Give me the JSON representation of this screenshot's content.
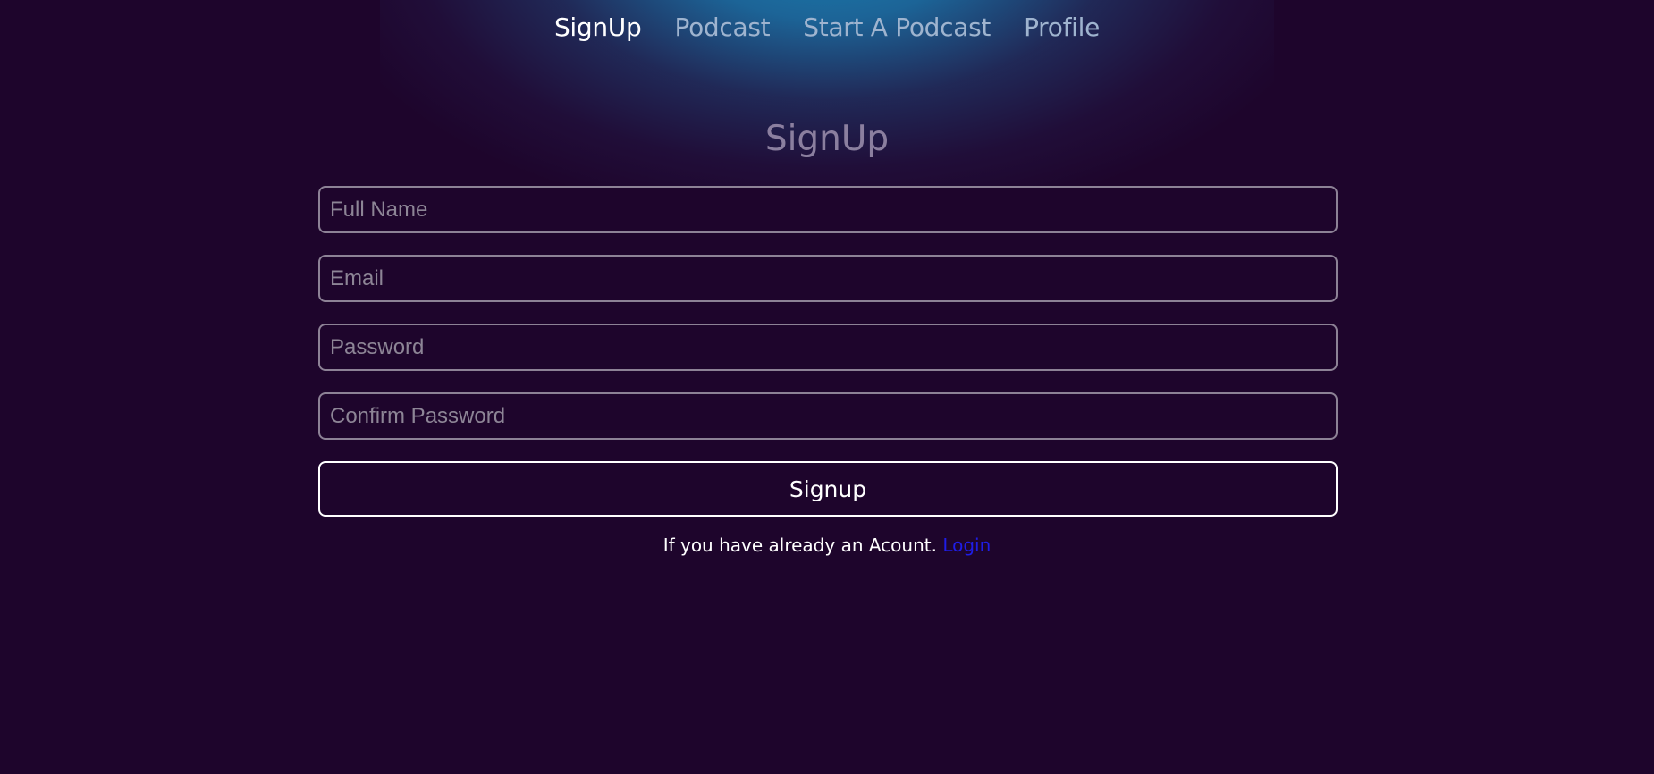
{
  "nav": {
    "items": [
      {
        "label": "SignUp",
        "active": true
      },
      {
        "label": "Podcast",
        "active": false
      },
      {
        "label": "Start A Podcast",
        "active": false
      },
      {
        "label": "Profile",
        "active": false
      }
    ]
  },
  "page": {
    "title": "SignUp"
  },
  "form": {
    "full_name": {
      "value": "",
      "placeholder": "Full Name"
    },
    "email": {
      "value": "",
      "placeholder": "Email"
    },
    "password": {
      "value": "",
      "placeholder": "Password"
    },
    "confirm_password": {
      "value": "",
      "placeholder": "Confirm Password"
    },
    "submit_label": "Signup"
  },
  "footer": {
    "prompt_text": "If you have already an Acount. ",
    "login_link": "Login"
  },
  "colors": {
    "background": "#1e052c",
    "glow": "#187eb0",
    "nav_active": "#ffffff",
    "nav_inactive": "#9fb4cf",
    "title": "#8b7f9f",
    "field_border": "#8d8296",
    "login_link": "#1f1de6"
  }
}
